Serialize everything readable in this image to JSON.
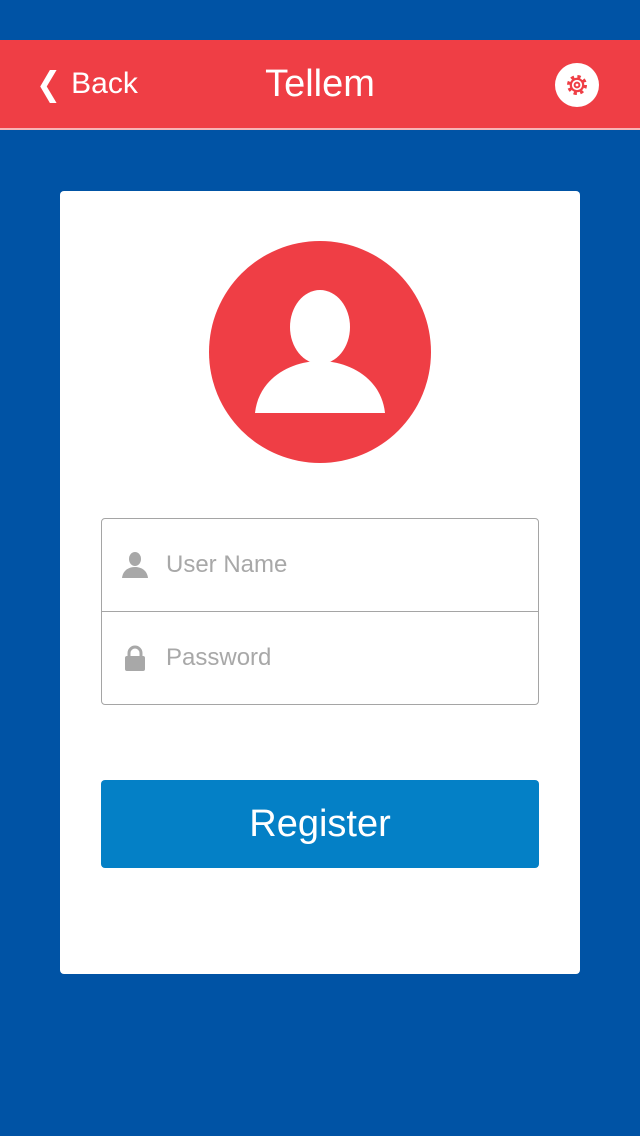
{
  "nav": {
    "back_label": "Back",
    "title": "Tellem",
    "back_icon": "chevron-left-icon",
    "settings_icon": "gear-icon"
  },
  "form": {
    "username": {
      "placeholder": "User Name",
      "value": "",
      "icon": "user-icon"
    },
    "password": {
      "placeholder": "Password",
      "value": "",
      "icon": "lock-icon"
    },
    "register_label": "Register"
  },
  "avatar": {
    "icon": "user-avatar-icon"
  },
  "colors": {
    "background": "#0053a5",
    "nav_bar": "#ef3e45",
    "accent_red": "#ef3e45",
    "card": "#ffffff",
    "button": "#0480c6",
    "placeholder": "#a8a8a8"
  }
}
